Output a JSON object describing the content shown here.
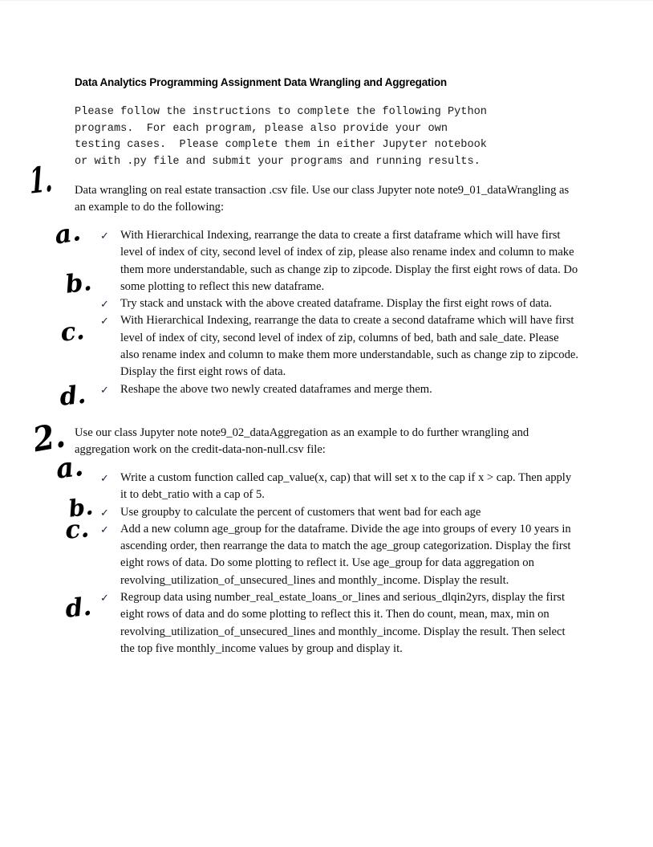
{
  "document": {
    "title": "Data Analytics Programming Assignment Data Wrangling and Aggregation",
    "intro": "Please follow the instructions to complete the following Python\nprograms.  For each program, please also provide your own\ntesting cases.  Please complete them in either Jupyter notebook\nor with .py file and submit your programs and running results."
  },
  "sections": [
    {
      "number": "1",
      "intro": "Data wrangling on real estate transaction .csv file. Use our class Jupyter note note9_01_dataWrangling as an example to do the following:",
      "bullets": [
        {
          "marker": "✓",
          "text": "With Hierarchical Indexing, rearrange the data to create a first dataframe which will have first level of index of city, second level of index of zip, please also rename index and column to make them more understandable, such as change zip to zipcode.  Display the first eight rows of data.  Do some plotting to reflect this new dataframe."
        },
        {
          "marker": "✓",
          "text": "Try stack and unstack with the above created dataframe.  Display the first eight rows of data."
        },
        {
          "marker": "✓",
          "text": "With Hierarchical Indexing, rearrange the data to create a second dataframe which will have first level of index of city, second level of index of zip, columns of bed, bath and sale_date.  Please also rename index and column to make them more understandable, such as change zip to zipcode.  Display the first eight rows of data."
        },
        {
          "marker": "✓",
          "text": "Reshape the above two newly created dataframes and merge them."
        }
      ]
    },
    {
      "number": "2",
      "intro": "Use our class Jupyter note note9_02_dataAggregation as an example to do further wrangling and aggregation work on the credit-data-non-null.csv file:",
      "bullets": [
        {
          "marker": "✓",
          "text": "Write a custom function called cap_value(x, cap) that will set x to the cap if x > cap.  Then apply it to debt_ratio with a cap of 5."
        },
        {
          "marker": "✓",
          "text": "Use groupby to calculate the percent of customers that went bad for each age"
        },
        {
          "marker": "✓",
          "text": "Add a new column age_group for the dataframe.  Divide the age into groups of every 10 years in ascending order, then rearrange the data to match the age_group categorization.  Display the first eight rows of data.  Do some plotting to reflect it.  Use age_group for data aggregation on revolving_utilization_of_unsecured_lines and monthly_income.  Display the result."
        },
        {
          "marker": "✓",
          "text": "Regroup data using number_real_estate_loans_or_lines and serious_dlqin2yrs, display the first eight rows of data and do some plotting to reflect this it. Then do count, mean, max, min on revolving_utilization_of_unsecured_lines and monthly_income.  Display the result.  Then select the top five monthly_income values by group and display it."
        }
      ]
    }
  ],
  "annotations": {
    "sec1_number": "1.",
    "sec1_a": "a.",
    "sec1_b": "b.",
    "sec1_c": "c.",
    "sec1_d": "d.",
    "sec2_number": "2.",
    "sec2_a": "a.",
    "sec2_b": "b.",
    "sec2_c": "c.",
    "sec2_d": "d."
  }
}
